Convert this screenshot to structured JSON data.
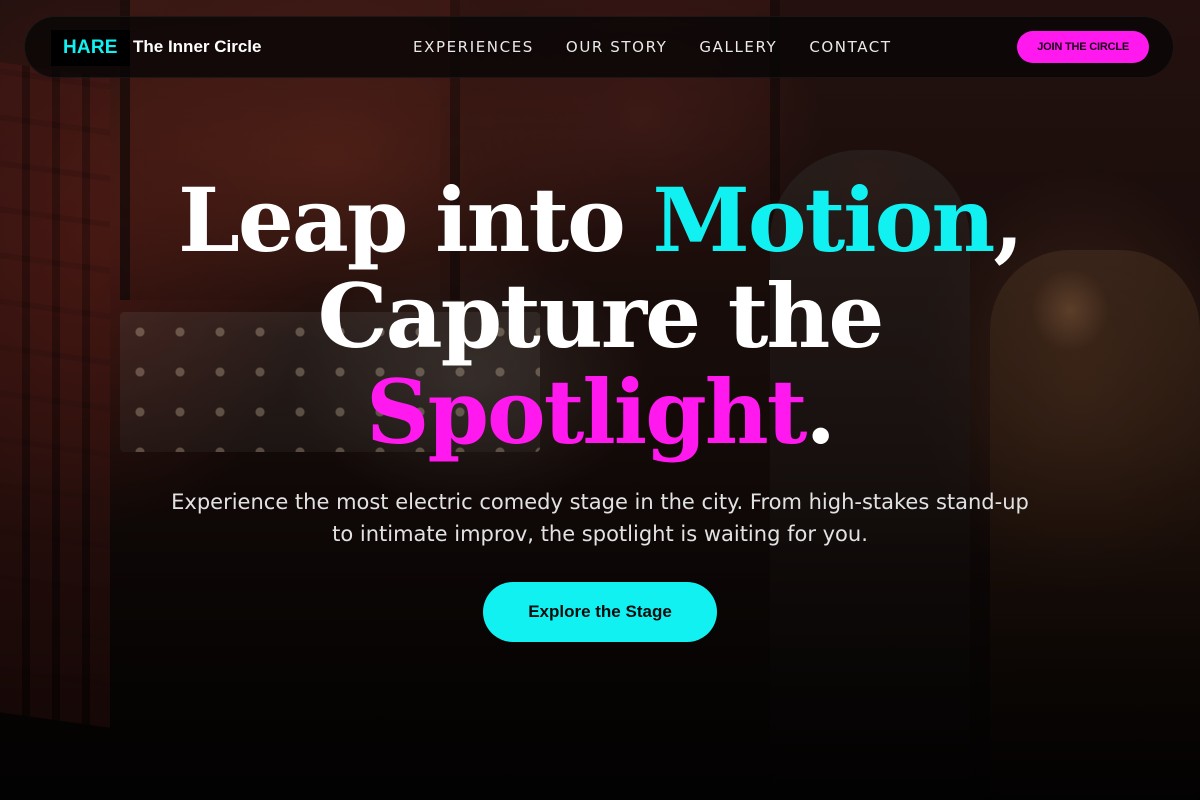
{
  "nav": {
    "logo": "HARE",
    "brand": "The Inner Circle",
    "links": [
      "EXPERIENCES",
      "OUR STORY",
      "GALLERY",
      "CONTACT"
    ],
    "cta": "JOIN THE CIRCLE"
  },
  "hero": {
    "line1_a": "Leap into ",
    "line1_highlight": "Motion",
    "line1_b": ",",
    "line2": "Capture the",
    "line3_highlight": "Spotlight",
    "line3_b": ".",
    "subtitle": "Experience the most electric comedy stage in the city. From high-stakes stand-up to intimate improv, the spotlight is waiting for you.",
    "cta": "Explore the Stage"
  },
  "colors": {
    "accent_cyan": "#12f1f1",
    "accent_magenta": "#ff19ee",
    "nav_background": "#080606"
  }
}
